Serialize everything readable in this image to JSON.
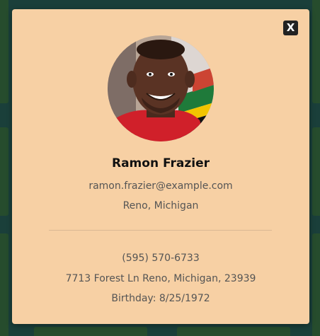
{
  "modal": {
    "close_label": "X",
    "name": "Ramon Frazier",
    "email": "ramon.frazier@example.com",
    "location": "Reno, Michigan",
    "phone": "(595) 570-6733",
    "address": "7713 Forest Ln Reno, Michigan, 23939",
    "birthday": "Birthday: 8/25/1972"
  },
  "colors": {
    "page_background": "#1f4a45",
    "card_background": "#2d5a35",
    "modal_background": "#f7d0a4",
    "close_button": "#222222"
  }
}
